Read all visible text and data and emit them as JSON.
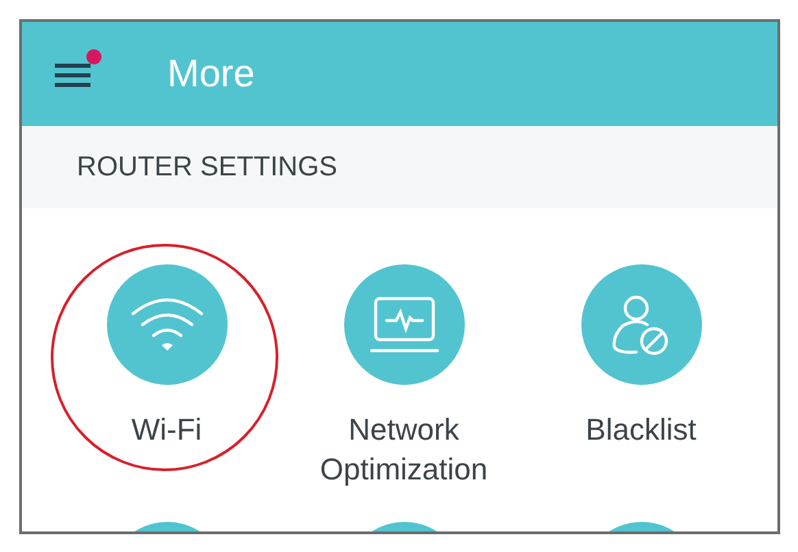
{
  "header": {
    "title": "More",
    "menu_badge": true
  },
  "section": {
    "title": "ROUTER SETTINGS"
  },
  "items": [
    {
      "kind": "wifi",
      "label": "Wi-Fi",
      "highlighted": true
    },
    {
      "kind": "network",
      "label": "Network Optimization",
      "highlighted": false
    },
    {
      "kind": "blacklist",
      "label": "Blacklist",
      "highlighted": false
    }
  ]
}
